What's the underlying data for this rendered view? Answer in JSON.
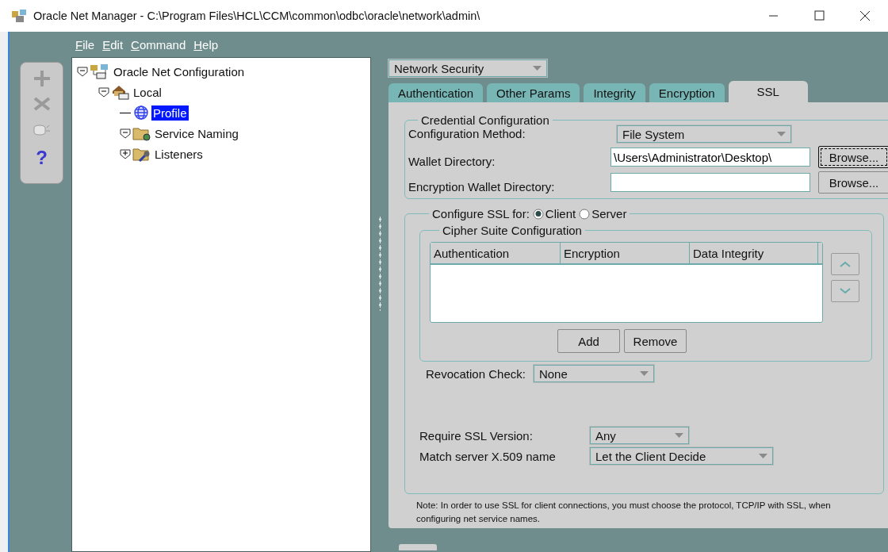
{
  "window": {
    "title": "Oracle Net Manager - C:\\Program Files\\HCL\\CCM\\common\\odbc\\oracle\\network\\admin\\"
  },
  "menu": [
    {
      "label": "File"
    },
    {
      "label": "Edit"
    },
    {
      "label": "Command"
    },
    {
      "label": "Help"
    }
  ],
  "toolbar": [
    {
      "kind": "add",
      "disabled": true
    },
    {
      "kind": "delete",
      "disabled": true
    },
    {
      "kind": "database",
      "disabled": true
    },
    {
      "kind": "help",
      "disabled": false,
      "label": "?"
    }
  ],
  "tree": [
    {
      "label": "Oracle Net Configuration",
      "kind": "network",
      "expanded": true,
      "selected": false,
      "children": [
        {
          "label": "Local",
          "kind": "house",
          "expanded": true,
          "selected": false,
          "children": [
            {
              "label": "Profile",
              "kind": "globe",
              "selected": true
            },
            {
              "label": "Service Naming",
              "kind": "folder",
              "expanded": true,
              "selected": false
            },
            {
              "label": "Listeners",
              "kind": "folder-key",
              "expanded": false,
              "selected": false
            }
          ]
        }
      ]
    }
  ],
  "view_select": {
    "value": "Network Security"
  },
  "tabs": [
    {
      "label": "Authentication",
      "selected": false
    },
    {
      "label": "Other Params",
      "selected": false
    },
    {
      "label": "Integrity",
      "selected": false
    },
    {
      "label": "Encryption",
      "selected": false
    },
    {
      "label": "SSL",
      "selected": true
    }
  ],
  "credential": {
    "title": "Credential Configuration",
    "rows": [
      {
        "kind": "select",
        "label": "Configuration Method:",
        "value": "File System"
      },
      {
        "kind": "path",
        "label": "Wallet Directory:",
        "value": "\\Users\\Administrator\\Desktop\\",
        "button": "Browse...",
        "focused": true
      },
      {
        "kind": "path",
        "label": "Encryption Wallet Directory:",
        "value": "",
        "button": "Browse...",
        "focused": false
      }
    ]
  },
  "ssl": {
    "label": "Configure SSL for:",
    "options": [
      {
        "label": "Client",
        "selected": true
      },
      {
        "label": "Server",
        "selected": false
      }
    ],
    "cipher": {
      "title": "Cipher Suite Configuration",
      "columns": [
        "Authentication",
        "Encryption",
        "Data Integrity"
      ],
      "buttons": [
        "Add",
        "Remove"
      ]
    },
    "revocation": {
      "label": "Revocation Check:",
      "value": "None"
    },
    "version": {
      "label": "Require SSL Version:",
      "value": "Any"
    },
    "match": {
      "label": "Match server X.509 name",
      "value": "Let the Client Decide"
    }
  },
  "note": "Note: In order to use SSL for client connections, you must choose the protocol, TCP/IP with SSL, when configuring net service names."
}
